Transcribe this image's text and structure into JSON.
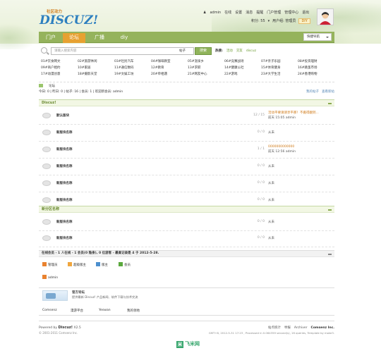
{
  "header": {
    "logo_cn": "社区动力",
    "logo_en": "DISCUZ!",
    "user_menu": [
      "admin",
      "在线",
      "设置",
      "消息",
      "提醒",
      "门户管理",
      "管理中心",
      "退出"
    ],
    "points_label": "积分: 55",
    "group_label": "用户组: 管理员",
    "gold_label": "DIY"
  },
  "nav": {
    "items": [
      "门户",
      "论坛",
      "广播",
      "diy"
    ],
    "active": "论坛",
    "quick_nav": "快捷导航"
  },
  "search": {
    "placeholder": "请输入搜索内容",
    "scope": "帖子",
    "button": "搜索",
    "hot_label": "热搜:",
    "hot": [
      "活动",
      "交友",
      "discuz"
    ]
  },
  "links": [
    [
      "01#饮食网文",
      "02#旅游休闲",
      "03#社民汽车",
      "04#咖啡教室",
      "05#温泉乡",
      "06#竞赛战场",
      "07#亲子乐园",
      "08#投资理财"
    ],
    [
      "09#商户相约",
      "10#家居",
      "11#通信数码",
      "12#教育",
      "13#求职",
      "14#健康公社",
      "15#体育健身",
      "16#跳蚤市场"
    ],
    [
      "17#动漫创意",
      "18#摄影天堂",
      "19#文娱工坊",
      "20#单相遇",
      "21#网友中心",
      "22#游戏",
      "23#大学生活",
      "24#香港购物"
    ]
  ],
  "breadcrumb": "论坛",
  "stats": {
    "left": "今日: 0 | 昨日: 0 | 帖子: 16 | 会员: 1 | 欢迎新会员: admin",
    "right": [
      "我的帖子",
      "查看新帖"
    ]
  },
  "categories": [
    {
      "title": "Discuz!",
      "forums": [
        {
          "name": "默认版块",
          "count": "12 / 15",
          "last_title": "活动平要请请享平那！不搬得翻到...",
          "last_time": "前天 15:05 admin"
        },
        {
          "name": "新版块名称",
          "count": "0 / 0",
          "last_title": "",
          "last_time": "从未"
        },
        {
          "name": "新版块名称",
          "count": "1 / 1",
          "last_title": "0000000000000",
          "last_time": "前天 12:56 admin"
        },
        {
          "name": "新版块名称",
          "count": "0 / 0",
          "last_title": "",
          "last_time": "从未"
        },
        {
          "name": "新版块名称",
          "count": "0 / 0",
          "last_title": "",
          "last_time": "从未"
        },
        {
          "name": "新版块名称",
          "count": "0 / 0",
          "last_title": "",
          "last_time": "从未"
        }
      ]
    },
    {
      "title": "新分区名称",
      "forums": [
        {
          "name": "新版块名称",
          "count": "0 / 0",
          "last_title": "",
          "last_time": "从未"
        },
        {
          "name": "新版块名称",
          "count": "0 / 0",
          "last_title": "",
          "last_time": "从未"
        }
      ]
    }
  ],
  "online": {
    "summary": "在线会员 - 1 人在线 - 1 会员(0 隐身), 0 位游客 - 最高记录是 4 于 2012-5-28.",
    "legend": [
      "管理员",
      "超级版主",
      "版主",
      "会员"
    ],
    "users": [
      "admin"
    ]
  },
  "friendlinks": {
    "title": "官方论坛",
    "desc": "提供最新 Discuz! 产品新闻、软件下载与技术交流",
    "links": [
      "Comsenz",
      "漫游平台",
      "Yeswan",
      "我的领地"
    ]
  },
  "footer": {
    "powered": "Powered by",
    "brand": "Discuz!",
    "version": "X2.5",
    "copyright": "© 2001-2011 Comsenz Inc.",
    "links": [
      "站点统计",
      "举报",
      "Archiver"
    ],
    "company": "Comsenz Inc.",
    "gmt": "GMT+8, 2012-5-31 17:23 , Processed in 0.064359 second(s), 16 queries, Template by moke3."
  },
  "watermark": "飞米网",
  "colors": {
    "nav_green": "#95b35c",
    "nav_active": "#e7a131",
    "accent_orange": "#d07a18",
    "logo_blue": "#2d7fbf"
  }
}
